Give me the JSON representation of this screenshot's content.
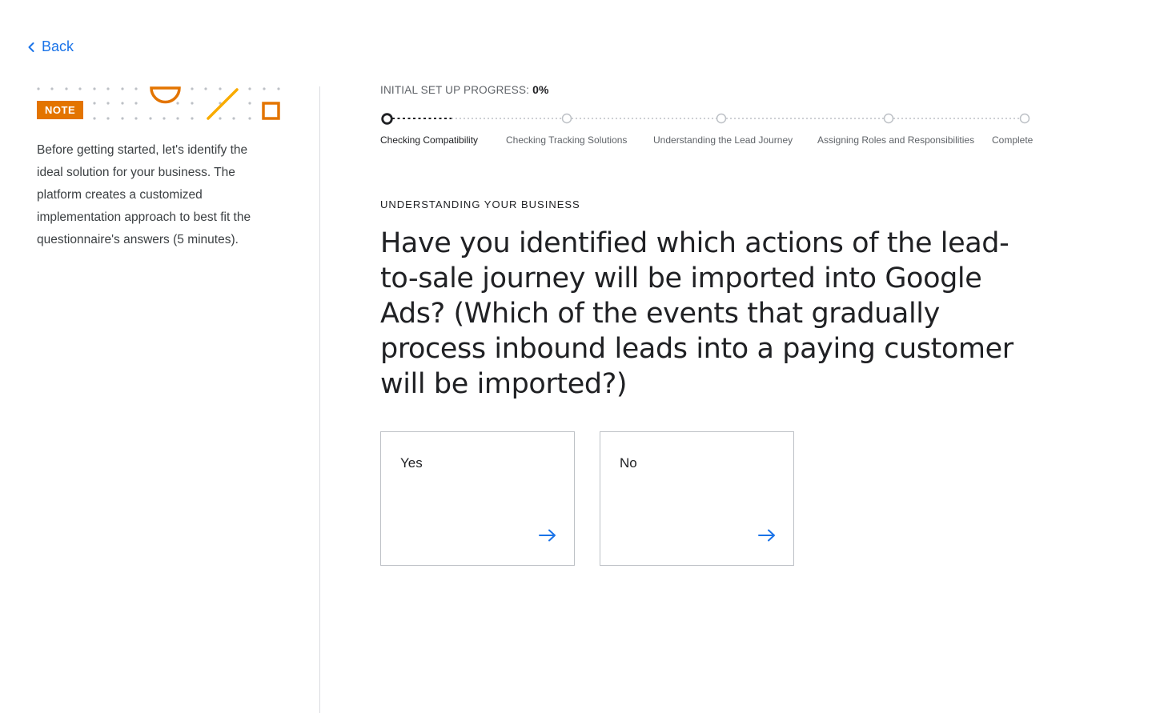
{
  "nav": {
    "back_label": "Back"
  },
  "note": {
    "badge": "NOTE",
    "text": "Before getting started, let's identify the ideal solution for your business. The platform creates a customized implementation approach to best fit the questionnaire's answers (5 minutes)."
  },
  "progress": {
    "title": "INITIAL SET UP PROGRESS:",
    "percent": "0%",
    "steps": [
      {
        "label": "Checking Compatibility",
        "active": true
      },
      {
        "label": "Checking Tracking Solutions",
        "active": false
      },
      {
        "label": "Understanding the Lead Journey",
        "active": false
      },
      {
        "label": "Assigning Roles and Responsibilities",
        "active": false
      },
      {
        "label": "Complete",
        "active": false
      }
    ]
  },
  "section": {
    "label": "UNDERSTANDING YOUR BUSINESS"
  },
  "question": {
    "text": "Have you identified which actions of the lead-to-sale journey will be imported into Google Ads? (Which of the events that gradually process inbound leads into a paying customer will be imported?)"
  },
  "options": [
    {
      "label": "Yes"
    },
    {
      "label": "No"
    }
  ],
  "colors": {
    "accent_blue": "#1a73e8",
    "note_orange": "#e37400",
    "decor_yellow": "#f9ab00",
    "border": "#dadce0"
  }
}
